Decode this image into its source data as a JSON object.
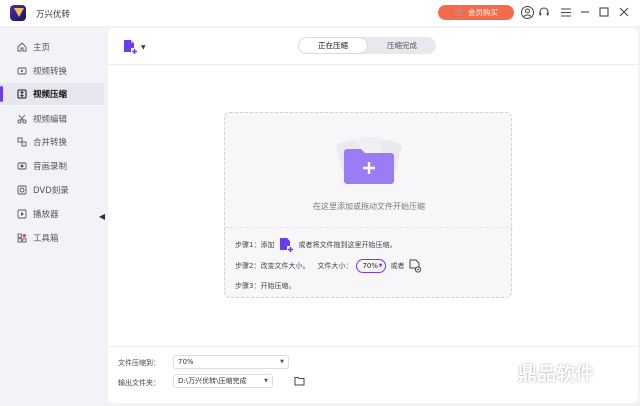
{
  "app": {
    "title": "万兴优转"
  },
  "titlebar": {
    "buy_label": "会员购买"
  },
  "sidebar": {
    "items": [
      {
        "label": "主页",
        "icon": "home-icon",
        "active": false
      },
      {
        "label": "视频转换",
        "icon": "video-convert-icon",
        "active": false
      },
      {
        "label": "视频压缩",
        "icon": "video-compress-icon",
        "active": true
      },
      {
        "label": "视频编辑",
        "icon": "scissors-icon",
        "active": false
      },
      {
        "label": "合并转换",
        "icon": "merge-icon",
        "active": false
      },
      {
        "label": "音画录制",
        "icon": "record-icon",
        "active": false
      },
      {
        "label": "DVD刻录",
        "icon": "dvd-icon",
        "active": false
      },
      {
        "label": "播放器",
        "icon": "player-icon",
        "active": false
      },
      {
        "label": "工具箱",
        "icon": "toolbox-icon",
        "active": false
      }
    ]
  },
  "tabs": [
    {
      "label": "正在压缩",
      "active": true
    },
    {
      "label": "压缩完成",
      "active": false
    }
  ],
  "dropzone": {
    "hint": "在这里添加或拖动文件开始压缩",
    "step1_prefix": "步骤1：添加",
    "step1_suffix": "或者将文件拖到这里开始压缩。",
    "step2_prefix": "步骤2：改变文件大小。",
    "step2_size_label": "文件大小：",
    "step2_size_value": "70%",
    "step2_or": "或者",
    "step3": "步骤3：开始压缩。"
  },
  "bottom": {
    "compress_label": "文件压缩到：",
    "compress_value": "70%",
    "output_label": "输出文件夹：",
    "output_value": "D:\\万兴优转\\压缩完成"
  },
  "watermark": {
    "text": "鼎品软件"
  },
  "colors": {
    "accent": "#6a3cf0",
    "buy": "#f36b4a",
    "folder": "#9b7cf3"
  }
}
